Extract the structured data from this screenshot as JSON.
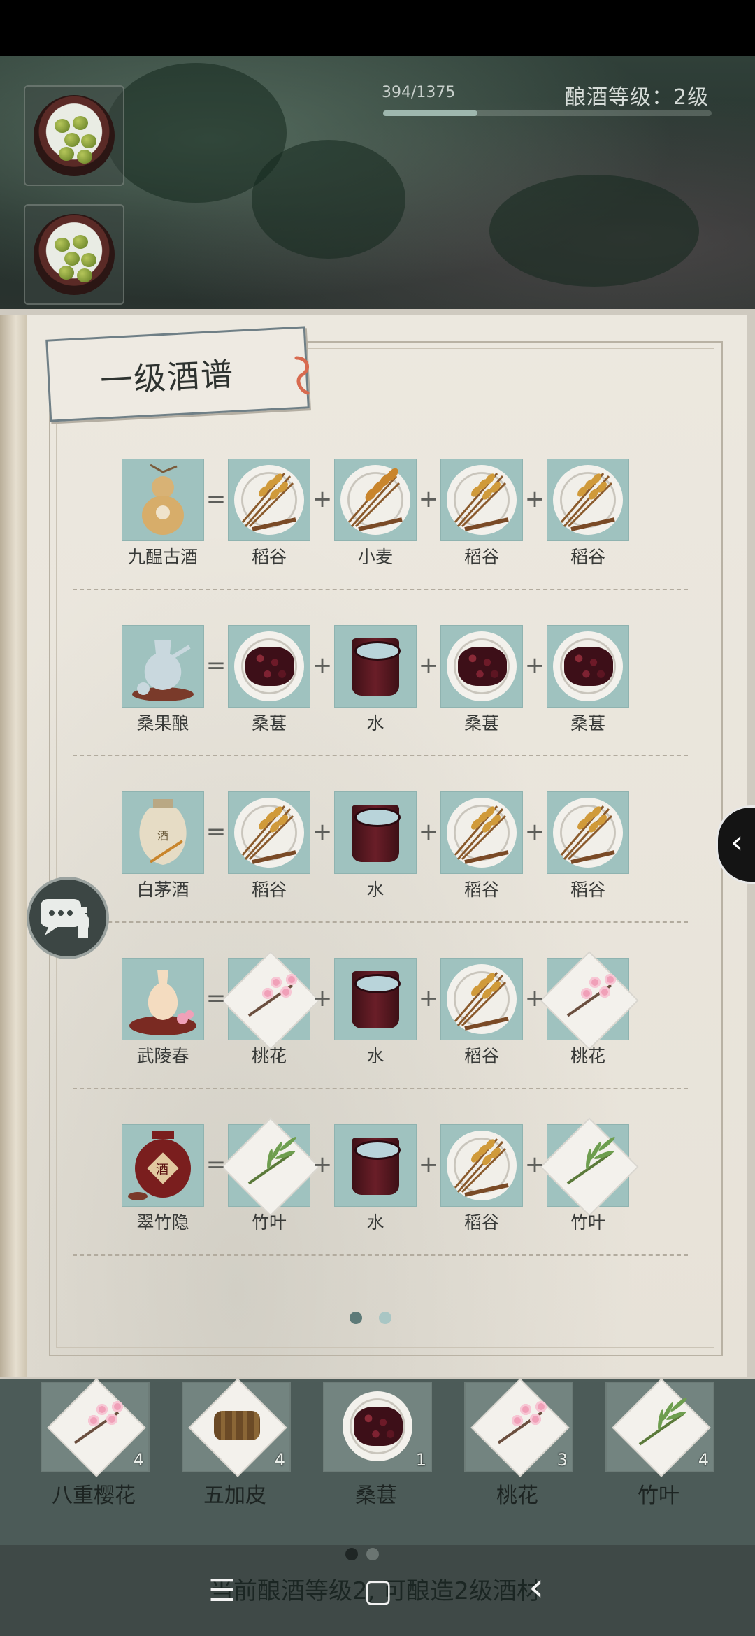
{
  "top": {
    "xp_text": "394/1375",
    "xp_fraction": 0.287,
    "level_text": "酿酒等级：2级"
  },
  "book": {
    "title": "一级酒谱",
    "recipes": [
      {
        "result": "九醖古酒",
        "result_icon": "gourd-wine-icon",
        "ingredients": [
          {
            "name": "稻谷",
            "icon": "rice-icon"
          },
          {
            "name": "小麦",
            "icon": "wheat-icon"
          },
          {
            "name": "稻谷",
            "icon": "rice-icon"
          },
          {
            "name": "稻谷",
            "icon": "rice-icon"
          }
        ]
      },
      {
        "result": "桑果酿",
        "result_icon": "mulberry-wine-icon",
        "ingredients": [
          {
            "name": "桑葚",
            "icon": "mulberry-icon"
          },
          {
            "name": "水",
            "icon": "water-bucket-icon"
          },
          {
            "name": "桑葚",
            "icon": "mulberry-icon"
          },
          {
            "name": "桑葚",
            "icon": "mulberry-icon"
          }
        ]
      },
      {
        "result": "白茅酒",
        "result_icon": "jar-wine-icon",
        "ingredients": [
          {
            "name": "稻谷",
            "icon": "rice-icon"
          },
          {
            "name": "水",
            "icon": "water-bucket-icon"
          },
          {
            "name": "稻谷",
            "icon": "rice-icon"
          },
          {
            "name": "稻谷",
            "icon": "rice-icon"
          }
        ]
      },
      {
        "result": "武陵春",
        "result_icon": "peach-wine-icon",
        "ingredients": [
          {
            "name": "桃花",
            "icon": "peach-blossom-icon"
          },
          {
            "name": "水",
            "icon": "water-bucket-icon"
          },
          {
            "name": "稻谷",
            "icon": "rice-icon"
          },
          {
            "name": "桃花",
            "icon": "peach-blossom-icon"
          }
        ]
      },
      {
        "result": "翠竹隐",
        "result_icon": "bamboo-wine-jar-icon",
        "ingredients": [
          {
            "name": "竹叶",
            "icon": "bamboo-leaf-icon"
          },
          {
            "name": "水",
            "icon": "water-bucket-icon"
          },
          {
            "name": "稻谷",
            "icon": "rice-icon"
          },
          {
            "name": "竹叶",
            "icon": "bamboo-leaf-icon"
          }
        ]
      }
    ],
    "ops": {
      "eq": "=",
      "plus": "+"
    },
    "page_count": 2,
    "current_page": 1
  },
  "inventory": [
    {
      "name": "八重樱花",
      "count": "4",
      "icon": "cherry-blossom-icon"
    },
    {
      "name": "五加皮",
      "count": "4",
      "icon": "bark-icon"
    },
    {
      "name": "桑葚",
      "count": "1",
      "icon": "mulberry-icon"
    },
    {
      "name": "桃花",
      "count": "3",
      "icon": "peach-blossom-icon"
    },
    {
      "name": "竹叶",
      "count": "4",
      "icon": "bamboo-leaf-icon"
    }
  ],
  "footer": {
    "brew_note": "当前酿酒等级2, 可酿造2级酒材",
    "nav": {
      "menu": "☰",
      "home": "▢",
      "back": "‹"
    }
  },
  "colors": {
    "cell": "#9fc2bf",
    "page": "#e7e2d8",
    "dot_active": "#5d7a78",
    "dot_inactive": "#a9c6c4"
  }
}
